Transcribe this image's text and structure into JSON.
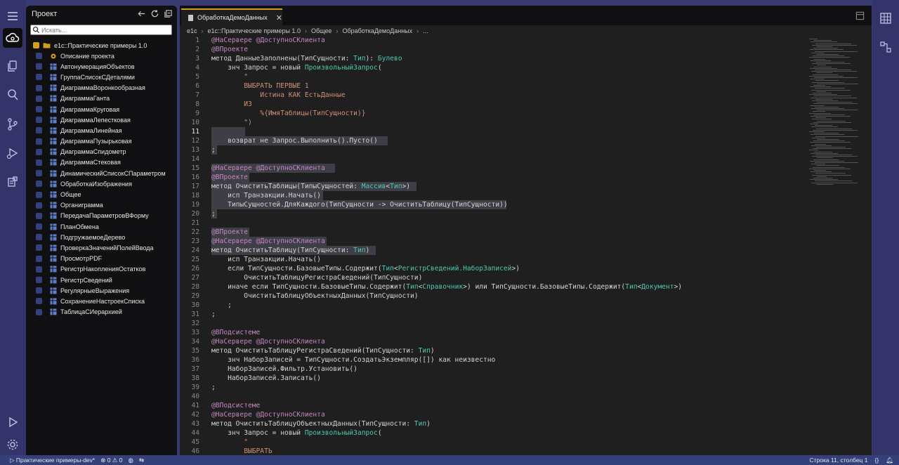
{
  "sidebar": {
    "title": "Проект",
    "search_placeholder": "Искать...",
    "root_label": "e1c::Практические примеры 1.0",
    "items": [
      {
        "label": "Описание проекта",
        "icon": "gear-icon"
      },
      {
        "label": "АвтонумерацияОбъектов",
        "icon": "form-icon"
      },
      {
        "label": "ГруппаСписокСДеталями",
        "icon": "form-icon"
      },
      {
        "label": "ДиаграммаВоронкообразная",
        "icon": "form-icon"
      },
      {
        "label": "ДиаграммаГанта",
        "icon": "form-icon"
      },
      {
        "label": "ДиаграммаКруговая",
        "icon": "form-icon"
      },
      {
        "label": "ДиаграммаЛепестковая",
        "icon": "form-icon"
      },
      {
        "label": "ДиаграммаЛинейная",
        "icon": "form-icon"
      },
      {
        "label": "ДиаграммаПузырьковая",
        "icon": "form-icon"
      },
      {
        "label": "ДиаграммаСпидометр",
        "icon": "form-icon"
      },
      {
        "label": "ДиаграммаСтековая",
        "icon": "form-icon"
      },
      {
        "label": "ДинамическийСписокСПараметром",
        "icon": "form-icon"
      },
      {
        "label": "ОбработкаИзображения",
        "icon": "form-icon"
      },
      {
        "label": "Общее",
        "icon": "form-icon"
      },
      {
        "label": "Органиграмма",
        "icon": "form-icon"
      },
      {
        "label": "ПередачаПараметровВФорму",
        "icon": "form-icon"
      },
      {
        "label": "ПланОбмена",
        "icon": "form-icon"
      },
      {
        "label": "ПодгружаемоеДерево",
        "icon": "form-icon"
      },
      {
        "label": "ПроверкаЗначенийПолейВвода",
        "icon": "form-icon"
      },
      {
        "label": "ПросмотрPDF",
        "icon": "form-icon"
      },
      {
        "label": "РегистрНакопленияОстатков",
        "icon": "form-icon"
      },
      {
        "label": "РегистрСведений",
        "icon": "form-icon"
      },
      {
        "label": "РегулярныеВыражения",
        "icon": "form-icon"
      },
      {
        "label": "СохранениеНастроекСписка",
        "icon": "form-icon"
      },
      {
        "label": "ТаблицаСИерархией",
        "icon": "form-icon"
      }
    ]
  },
  "editor": {
    "tab_label": "ОбработкаДемоДанных",
    "close_glyph": "✕",
    "breadcrumb": [
      "e1c",
      "e1c::Практические примеры 1.0",
      "Общее",
      "ОбработкаДемоДанных",
      "..."
    ],
    "lines": [
      {
        "n": "1",
        "t": "@НаСервере @ДоступноСКлиента"
      },
      {
        "n": "2",
        "t": "@ВПроекте"
      },
      {
        "n": "3",
        "t": "метод ДанныеЗаполнены(ТипСущности: Тип): Булево"
      },
      {
        "n": "4",
        "t": "    знч Запрос = новый ПроизвольныйЗапрос("
      },
      {
        "n": "5",
        "t": "        \""
      },
      {
        "n": "6",
        "t": "        ВЫБРАТЬ ПЕРВЫЕ 1"
      },
      {
        "n": "7",
        "t": "            Истина КАК ЕстьДанные"
      },
      {
        "n": "8",
        "t": "        ИЗ"
      },
      {
        "n": "9",
        "t": "            %{ИмяТаблицы(ТипСущности)}"
      },
      {
        "n": "10",
        "t": "        \")"
      },
      {
        "n": "11",
        "t": ""
      },
      {
        "n": "12",
        "t": "    возврат не Запрос.Выполнить().Пусто()"
      },
      {
        "n": "13",
        "t": ";"
      },
      {
        "n": "14",
        "t": ""
      },
      {
        "n": "15",
        "t": "@НаСервере @ДоступноСКлиента"
      },
      {
        "n": "16",
        "t": "@ВПроекте"
      },
      {
        "n": "17",
        "t": "метод ОчиститьТаблицы(ТипыСущностей: Массив<Тип>)"
      },
      {
        "n": "18",
        "t": "    исп Транзакции.Начать()"
      },
      {
        "n": "19",
        "t": "    ТипыСущностей.ДляКаждого(ТипСущности -> ОчиститьТаблицу(ТипСущности))"
      },
      {
        "n": "20",
        "t": ";"
      },
      {
        "n": "21",
        "t": ""
      },
      {
        "n": "22",
        "t": "@ВПроекте"
      },
      {
        "n": "23",
        "t": "@НаСервере @ДоступноСКлиента"
      },
      {
        "n": "24",
        "t": "метод ОчиститьТаблицу(ТипСущности: Тип)"
      },
      {
        "n": "25",
        "t": "    исп Транзакции.Начать()"
      },
      {
        "n": "26",
        "t": "    если ТипСущности.БазовыеТипы.Содержит(Тип<РегистрСведений.НаборЗаписей>)"
      },
      {
        "n": "27",
        "t": "        ОчиститьТаблицуРегистраСведений(ТипСущности)"
      },
      {
        "n": "28",
        "t": "    иначе если ТипСущности.БазовыеТипы.Содержит(Тип<Справочник>) или ТипСущности.БазовыеТипы.Содержит(Тип<Документ>)"
      },
      {
        "n": "29",
        "t": "        ОчиститьТаблицуОбъектныхДанных(ТипСущности)"
      },
      {
        "n": "30",
        "t": "    ;"
      },
      {
        "n": "31",
        "t": ";"
      },
      {
        "n": "32",
        "t": ""
      },
      {
        "n": "33",
        "t": "@ВПодсистеме"
      },
      {
        "n": "34",
        "t": "@НаСервере @ДоступноСКлиента"
      },
      {
        "n": "35",
        "t": "метод ОчиститьТаблицуРегистраСведений(ТипСущности: Тип)"
      },
      {
        "n": "36",
        "t": "    знч НаборЗаписей = ТипСущности.СоздатьЭкземпляр([]) как неизвестно"
      },
      {
        "n": "37",
        "t": "    НаборЗаписей.Фильтр.Установить()"
      },
      {
        "n": "38",
        "t": "    НаборЗаписей.Записать()"
      },
      {
        "n": "39",
        "t": ";"
      },
      {
        "n": "40",
        "t": ""
      },
      {
        "n": "41",
        "t": "@ВПодсистеме"
      },
      {
        "n": "42",
        "t": "@НаСервере @ДоступноСКлиента"
      },
      {
        "n": "43",
        "t": "метод ОчиститьТаблицуОбъектныхДанных(ТипСущности: Тип)"
      },
      {
        "n": "44",
        "t": "    знч Запрос = новый ПроизвольныйЗапрос("
      },
      {
        "n": "45",
        "t": "        \""
      },
      {
        "n": "46",
        "t": "        ВЫБРАТЬ"
      }
    ]
  },
  "status": {
    "project": "Практические примеры-dev*",
    "errors": "0",
    "warnings": "0",
    "position": "Строка 11, столбец 1",
    "braces": "{}"
  },
  "colors": {
    "accent": "#d49d1d",
    "status_bar": "#33407a",
    "frame": "#3a3a72",
    "keyword": "#d4d4d4",
    "annotation": "#c586c0",
    "function": "#dcdcaa",
    "type": "#4ec9b0",
    "string": "#ce9178"
  }
}
